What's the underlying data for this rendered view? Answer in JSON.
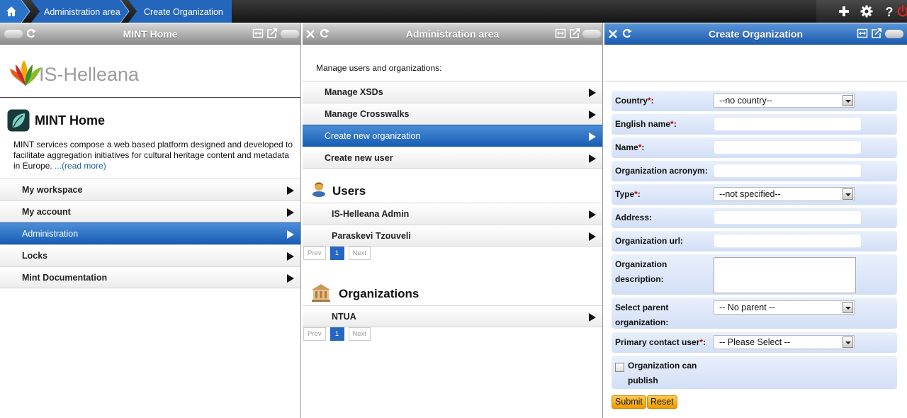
{
  "breadcrumbs": [
    "Administration area",
    "Create Organization"
  ],
  "panel1": {
    "title": "MINT Home",
    "logo_text": "IS-Helleana",
    "heading": "MINT Home",
    "description": "MINT services compose a web based platform designed and developed to facilitate aggregation initiatives for cultural heritage content and metadata in Europe. ",
    "read_more": "...(read more)",
    "menu": [
      {
        "label": "My workspace",
        "selected": false
      },
      {
        "label": "My account",
        "selected": false
      },
      {
        "label": "Administration",
        "selected": true
      },
      {
        "label": "Locks",
        "selected": false
      },
      {
        "label": "Mint Documentation",
        "selected": false
      }
    ]
  },
  "panel2": {
    "title": "Administration area",
    "intro": "Manage users and organizations:",
    "menu": [
      {
        "label": "Manage XSDs",
        "selected": false
      },
      {
        "label": "Manage Crosswalks",
        "selected": false
      },
      {
        "label": "Create new organization",
        "selected": true
      },
      {
        "label": "Create new user",
        "selected": false
      }
    ],
    "users_title": "Users",
    "users": [
      "IS-Helleana Admin",
      "Paraskevi Tzouveli"
    ],
    "orgs_title": "Organizations",
    "orgs": [
      "NTUA"
    ],
    "pager": {
      "prev": "Prev",
      "page": "1",
      "next": "Next"
    }
  },
  "panel3": {
    "title": "Create Organization",
    "fields": {
      "country": {
        "label": "Country",
        "required": "*",
        "value": "--no country--"
      },
      "english_name": {
        "label": "English name",
        "required": "*",
        "value": ""
      },
      "name": {
        "label": "Name",
        "required": "*",
        "value": ""
      },
      "acronym": {
        "label": "Organization acronym:",
        "value": ""
      },
      "type": {
        "label": "Type",
        "required": "*",
        "value": "--not specified--"
      },
      "address": {
        "label": "Address:",
        "value": ""
      },
      "url": {
        "label": "Organization url:",
        "value": ""
      },
      "description": {
        "label_line1": "Organization",
        "label_line2": "description:",
        "value": ""
      },
      "parent": {
        "label_line1": "Select parent",
        "label_line2": "organization:",
        "value": "-- No parent --"
      },
      "contact": {
        "label": "Primary contact user",
        "required": "*",
        "value": "-- Please Select --"
      },
      "can_publish": {
        "label_line1": "Organization can",
        "label_line2": "publish",
        "checked": false
      }
    },
    "submit": "Submit",
    "reset": "Reset"
  },
  "colors": {
    "accent_blue": "#1a5cb0",
    "button_orange": "#f5a300",
    "required_red": "#cc0000",
    "logout_red": "#e02020"
  },
  "icons": [
    "home-icon",
    "plus-icon",
    "gear-icon",
    "help-icon",
    "power-icon",
    "close-icon",
    "refresh-icon",
    "expand-icon",
    "popout-icon",
    "user-icon",
    "building-icon",
    "mint-logo-icon",
    "leaf-logo-icon"
  ]
}
